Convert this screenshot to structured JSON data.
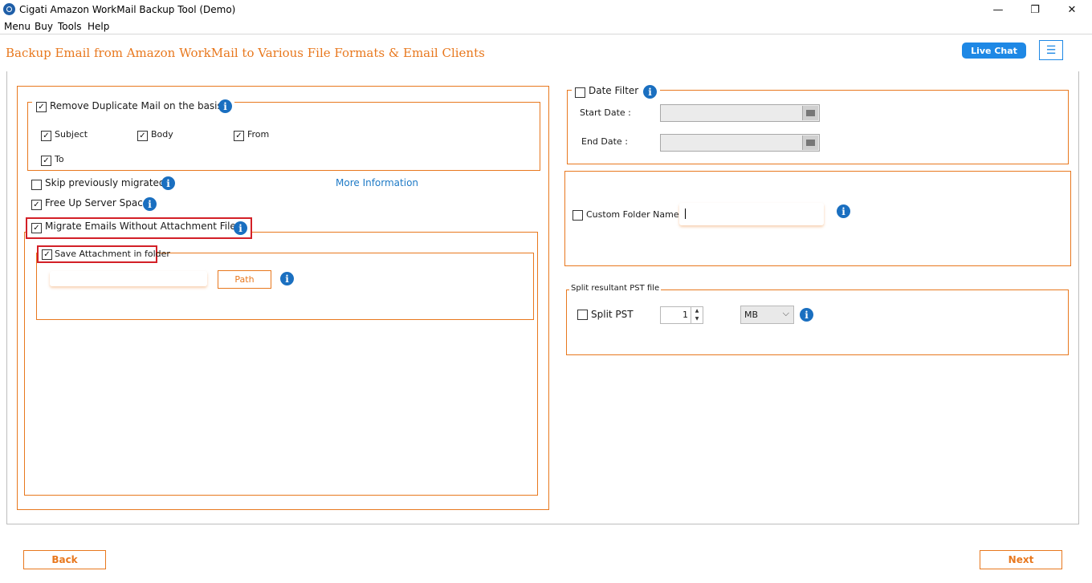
{
  "window": {
    "title": "Cigati Amazon WorkMail Backup Tool (Demo)",
    "controls": {
      "minimize": "—",
      "maximize": "❐",
      "close": "✕"
    }
  },
  "menu": [
    "Menu",
    "Buy",
    "Tools",
    "Help"
  ],
  "header": {
    "title": "Backup Email from Amazon WorkMail to Various File Formats & Email Clients",
    "live_chat": "Live Chat",
    "menu_icon": "☰"
  },
  "left": {
    "remove_duplicate": {
      "label": "Remove Duplicate Mail on the basis",
      "checked": true
    },
    "dup_options": [
      {
        "label": "Subject",
        "checked": true
      },
      {
        "label": "Body",
        "checked": true
      },
      {
        "label": "From",
        "checked": true
      },
      {
        "label": "To",
        "checked": true
      }
    ],
    "skip_migrated": {
      "label": "Skip previously migrated",
      "checked": false
    },
    "more_information": "More Information",
    "free_up": {
      "label": "Free Up Server Space",
      "checked": true
    },
    "migrate_without_attachments": {
      "label": "Migrate Emails Without Attachment Files",
      "checked": true
    },
    "save_attachment": {
      "label": "Save Attachment in folder",
      "checked": true
    },
    "path_value": "",
    "path_button": "Path"
  },
  "right": {
    "date_filter": {
      "label": "Date Filter",
      "checked": false
    },
    "start_date_label": "Start Date :",
    "end_date_label": "End Date :",
    "start_date_value": "",
    "end_date_value": "",
    "custom_folder": {
      "label": "Custom Folder Name",
      "checked": false,
      "value": ""
    },
    "split_group_title": "Split resultant PST file",
    "split_pst": {
      "label": "Split PST",
      "checked": false
    },
    "split_size": "1",
    "split_unit": "MB"
  },
  "footer": {
    "back": "Back",
    "next": "Next"
  },
  "icons": {
    "info": "i",
    "check": "✓",
    "caret": "⌵"
  },
  "colors": {
    "accent": "#e8781e",
    "info": "#1a6fc0",
    "highlight": "#d32027",
    "live_chat": "#1e88e5"
  }
}
